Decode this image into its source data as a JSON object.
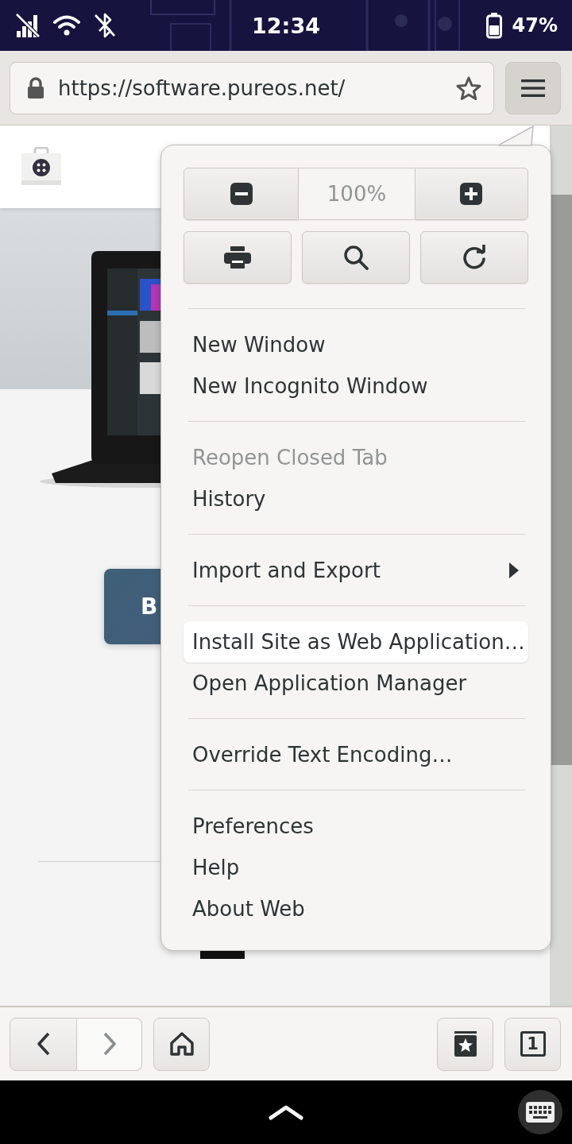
{
  "status_bar": {
    "time": "12:34",
    "battery_percent": "47%"
  },
  "address_bar": {
    "url": "https://software.pureos.net/"
  },
  "menu_button": {
    "pressed": true
  },
  "page": {
    "button_text": "B"
  },
  "menu": {
    "zoom_level": "100%",
    "sections": [
      [
        {
          "label": "New Window",
          "kind": "item",
          "disabled": false,
          "highlighted": false
        },
        {
          "label": "New Incognito Window",
          "kind": "item",
          "disabled": false,
          "highlighted": false
        }
      ],
      [
        {
          "label": "Reopen Closed Tab",
          "kind": "item",
          "disabled": true,
          "highlighted": false
        },
        {
          "label": "History",
          "kind": "item",
          "disabled": false,
          "highlighted": false
        }
      ],
      [
        {
          "label": "Import and Export",
          "kind": "submenu",
          "disabled": false,
          "highlighted": false
        }
      ],
      [
        {
          "label": "Install Site as Web Application…",
          "kind": "item",
          "disabled": false,
          "highlighted": true
        },
        {
          "label": "Open Application Manager",
          "kind": "item",
          "disabled": false,
          "highlighted": false
        }
      ],
      [
        {
          "label": "Override Text Encoding…",
          "kind": "item",
          "disabled": false,
          "highlighted": false
        }
      ],
      [
        {
          "label": "Preferences",
          "kind": "item",
          "disabled": false,
          "highlighted": false
        },
        {
          "label": "Help",
          "kind": "item",
          "disabled": false,
          "highlighted": false
        },
        {
          "label": "About Web",
          "kind": "item",
          "disabled": false,
          "highlighted": false
        }
      ]
    ]
  },
  "bottom_bar": {
    "back_disabled": false,
    "forward_disabled": true,
    "tab_count": "1"
  }
}
